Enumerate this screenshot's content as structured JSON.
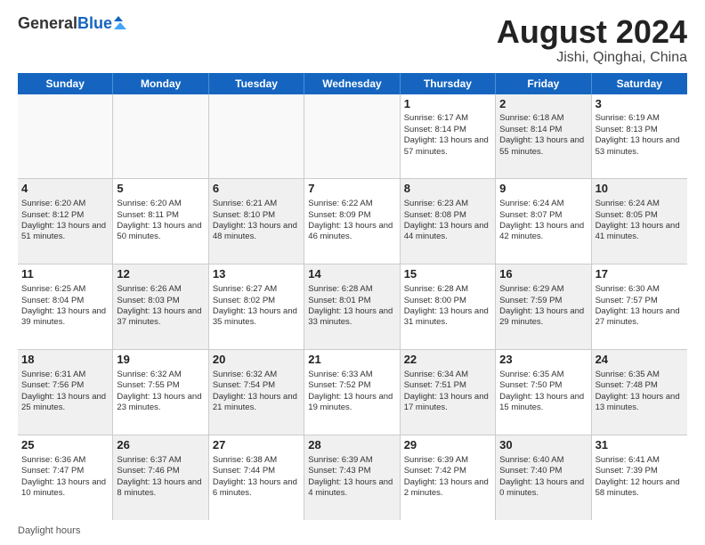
{
  "header": {
    "logo_general": "General",
    "logo_blue": "Blue",
    "month_year": "August 2024",
    "location": "Jishi, Qinghai, China"
  },
  "days_of_week": [
    "Sunday",
    "Monday",
    "Tuesday",
    "Wednesday",
    "Thursday",
    "Friday",
    "Saturday"
  ],
  "footer": {
    "daylight_label": "Daylight hours"
  },
  "weeks": [
    {
      "cells": [
        {
          "day": "",
          "info": "",
          "shaded": false,
          "empty": true
        },
        {
          "day": "",
          "info": "",
          "shaded": false,
          "empty": true
        },
        {
          "day": "",
          "info": "",
          "shaded": false,
          "empty": true
        },
        {
          "day": "",
          "info": "",
          "shaded": false,
          "empty": true
        },
        {
          "day": "1",
          "info": "Sunrise: 6:17 AM\nSunset: 8:14 PM\nDaylight: 13 hours and 57 minutes.",
          "shaded": false,
          "empty": false
        },
        {
          "day": "2",
          "info": "Sunrise: 6:18 AM\nSunset: 8:14 PM\nDaylight: 13 hours and 55 minutes.",
          "shaded": true,
          "empty": false
        },
        {
          "day": "3",
          "info": "Sunrise: 6:19 AM\nSunset: 8:13 PM\nDaylight: 13 hours and 53 minutes.",
          "shaded": false,
          "empty": false
        }
      ]
    },
    {
      "cells": [
        {
          "day": "4",
          "info": "Sunrise: 6:20 AM\nSunset: 8:12 PM\nDaylight: 13 hours and 51 minutes.",
          "shaded": true,
          "empty": false
        },
        {
          "day": "5",
          "info": "Sunrise: 6:20 AM\nSunset: 8:11 PM\nDaylight: 13 hours and 50 minutes.",
          "shaded": false,
          "empty": false
        },
        {
          "day": "6",
          "info": "Sunrise: 6:21 AM\nSunset: 8:10 PM\nDaylight: 13 hours and 48 minutes.",
          "shaded": true,
          "empty": false
        },
        {
          "day": "7",
          "info": "Sunrise: 6:22 AM\nSunset: 8:09 PM\nDaylight: 13 hours and 46 minutes.",
          "shaded": false,
          "empty": false
        },
        {
          "day": "8",
          "info": "Sunrise: 6:23 AM\nSunset: 8:08 PM\nDaylight: 13 hours and 44 minutes.",
          "shaded": true,
          "empty": false
        },
        {
          "day": "9",
          "info": "Sunrise: 6:24 AM\nSunset: 8:07 PM\nDaylight: 13 hours and 42 minutes.",
          "shaded": false,
          "empty": false
        },
        {
          "day": "10",
          "info": "Sunrise: 6:24 AM\nSunset: 8:05 PM\nDaylight: 13 hours and 41 minutes.",
          "shaded": true,
          "empty": false
        }
      ]
    },
    {
      "cells": [
        {
          "day": "11",
          "info": "Sunrise: 6:25 AM\nSunset: 8:04 PM\nDaylight: 13 hours and 39 minutes.",
          "shaded": false,
          "empty": false
        },
        {
          "day": "12",
          "info": "Sunrise: 6:26 AM\nSunset: 8:03 PM\nDaylight: 13 hours and 37 minutes.",
          "shaded": true,
          "empty": false
        },
        {
          "day": "13",
          "info": "Sunrise: 6:27 AM\nSunset: 8:02 PM\nDaylight: 13 hours and 35 minutes.",
          "shaded": false,
          "empty": false
        },
        {
          "day": "14",
          "info": "Sunrise: 6:28 AM\nSunset: 8:01 PM\nDaylight: 13 hours and 33 minutes.",
          "shaded": true,
          "empty": false
        },
        {
          "day": "15",
          "info": "Sunrise: 6:28 AM\nSunset: 8:00 PM\nDaylight: 13 hours and 31 minutes.",
          "shaded": false,
          "empty": false
        },
        {
          "day": "16",
          "info": "Sunrise: 6:29 AM\nSunset: 7:59 PM\nDaylight: 13 hours and 29 minutes.",
          "shaded": true,
          "empty": false
        },
        {
          "day": "17",
          "info": "Sunrise: 6:30 AM\nSunset: 7:57 PM\nDaylight: 13 hours and 27 minutes.",
          "shaded": false,
          "empty": false
        }
      ]
    },
    {
      "cells": [
        {
          "day": "18",
          "info": "Sunrise: 6:31 AM\nSunset: 7:56 PM\nDaylight: 13 hours and 25 minutes.",
          "shaded": true,
          "empty": false
        },
        {
          "day": "19",
          "info": "Sunrise: 6:32 AM\nSunset: 7:55 PM\nDaylight: 13 hours and 23 minutes.",
          "shaded": false,
          "empty": false
        },
        {
          "day": "20",
          "info": "Sunrise: 6:32 AM\nSunset: 7:54 PM\nDaylight: 13 hours and 21 minutes.",
          "shaded": true,
          "empty": false
        },
        {
          "day": "21",
          "info": "Sunrise: 6:33 AM\nSunset: 7:52 PM\nDaylight: 13 hours and 19 minutes.",
          "shaded": false,
          "empty": false
        },
        {
          "day": "22",
          "info": "Sunrise: 6:34 AM\nSunset: 7:51 PM\nDaylight: 13 hours and 17 minutes.",
          "shaded": true,
          "empty": false
        },
        {
          "day": "23",
          "info": "Sunrise: 6:35 AM\nSunset: 7:50 PM\nDaylight: 13 hours and 15 minutes.",
          "shaded": false,
          "empty": false
        },
        {
          "day": "24",
          "info": "Sunrise: 6:35 AM\nSunset: 7:48 PM\nDaylight: 13 hours and 13 minutes.",
          "shaded": true,
          "empty": false
        }
      ]
    },
    {
      "cells": [
        {
          "day": "25",
          "info": "Sunrise: 6:36 AM\nSunset: 7:47 PM\nDaylight: 13 hours and 10 minutes.",
          "shaded": false,
          "empty": false
        },
        {
          "day": "26",
          "info": "Sunrise: 6:37 AM\nSunset: 7:46 PM\nDaylight: 13 hours and 8 minutes.",
          "shaded": true,
          "empty": false
        },
        {
          "day": "27",
          "info": "Sunrise: 6:38 AM\nSunset: 7:44 PM\nDaylight: 13 hours and 6 minutes.",
          "shaded": false,
          "empty": false
        },
        {
          "day": "28",
          "info": "Sunrise: 6:39 AM\nSunset: 7:43 PM\nDaylight: 13 hours and 4 minutes.",
          "shaded": true,
          "empty": false
        },
        {
          "day": "29",
          "info": "Sunrise: 6:39 AM\nSunset: 7:42 PM\nDaylight: 13 hours and 2 minutes.",
          "shaded": false,
          "empty": false
        },
        {
          "day": "30",
          "info": "Sunrise: 6:40 AM\nSunset: 7:40 PM\nDaylight: 13 hours and 0 minutes.",
          "shaded": true,
          "empty": false
        },
        {
          "day": "31",
          "info": "Sunrise: 6:41 AM\nSunset: 7:39 PM\nDaylight: 12 hours and 58 minutes.",
          "shaded": false,
          "empty": false
        }
      ]
    }
  ]
}
